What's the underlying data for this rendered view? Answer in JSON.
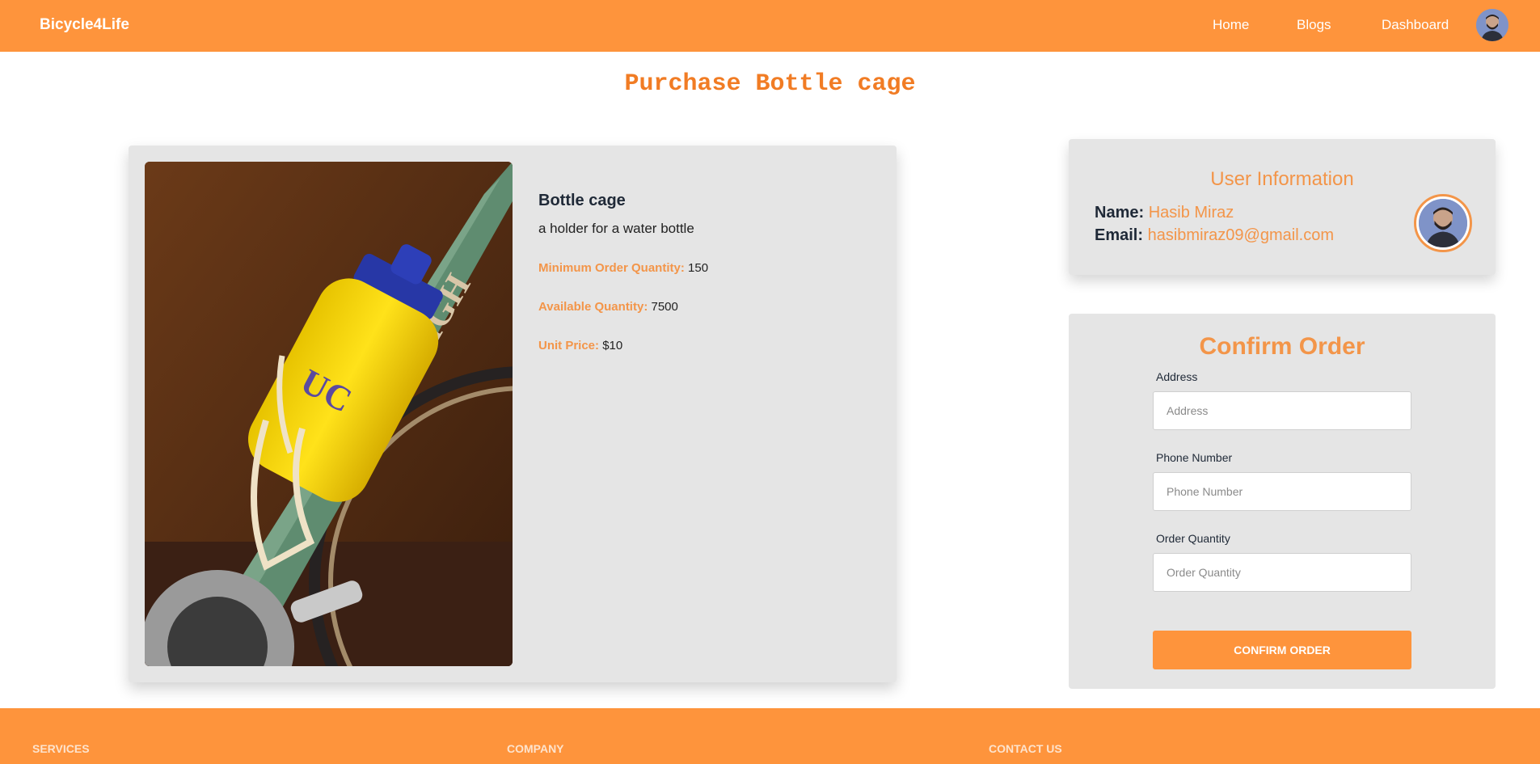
{
  "navbar": {
    "brand": "Bicycle4Life",
    "links": [
      "Home",
      "Blogs",
      "Dashboard"
    ],
    "avatar_icon": "user-avatar",
    "bg_color": "#fe943c"
  },
  "page": {
    "title": "Purchase Bottle cage"
  },
  "product": {
    "name": "Bottle cage",
    "description": "a holder for a water bottle",
    "min_order_label": "Minimum Order Quantity:",
    "min_order_value": "150",
    "available_label": "Available Quantity:",
    "available_value": "7500",
    "price_label": "Unit Price:",
    "price_value": "$10",
    "image_text": "RALEIGH"
  },
  "user_info": {
    "heading": "User Information",
    "name_label": "Name:",
    "name_value": "Hasib Miraz",
    "email_label": "Email:",
    "email_value": "hasibmiraz09@gmail.com"
  },
  "order_form": {
    "heading": "Confirm Order",
    "address_label": "Address",
    "address_placeholder": "Address",
    "phone_label": "Phone Number",
    "phone_placeholder": "Phone Number",
    "quantity_label": "Order Quantity",
    "quantity_placeholder": "Order Quantity",
    "submit_label": "Confirm Order"
  },
  "footer": {
    "headings": [
      "Services",
      "Company",
      "Contact us"
    ]
  },
  "colors": {
    "accent": "#f39549",
    "brand": "#fe943c",
    "card_bg": "#e5e5e5",
    "title": "#f17c24"
  }
}
